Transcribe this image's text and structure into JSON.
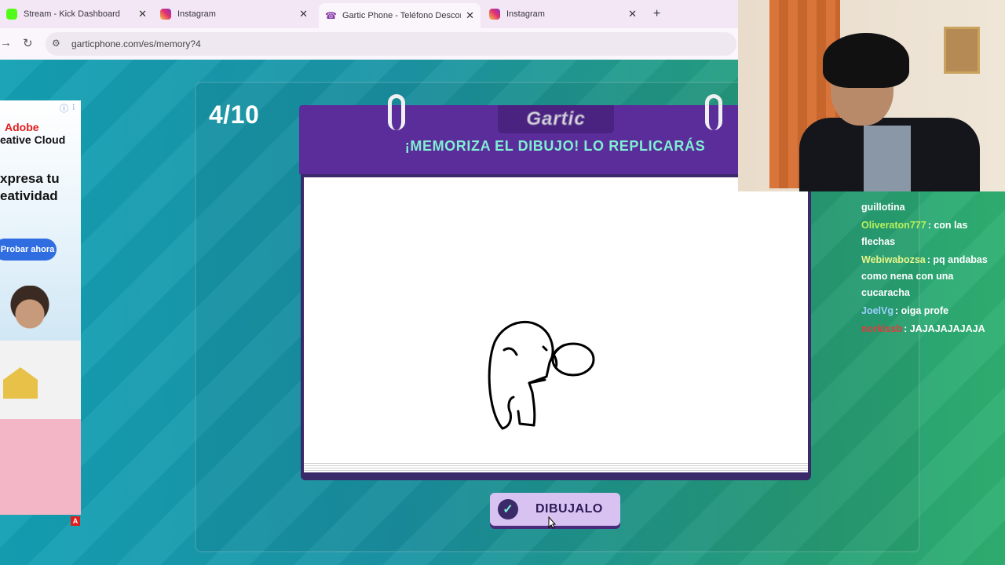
{
  "browser": {
    "tabs": [
      {
        "title": "Stream - Kick Dashboard",
        "favicon": "kick-icon"
      },
      {
        "title": "Instagram",
        "favicon": "instagram-icon"
      },
      {
        "title": "Gartic Phone - Teléfono Descon",
        "favicon": "phone-icon",
        "active": true
      },
      {
        "title": "Instagram",
        "favicon": "instagram-icon"
      }
    ],
    "new_tab_label": "+",
    "close_label": "✕",
    "url": "garticphone.com/es/memory?4"
  },
  "game": {
    "counter": "4/10",
    "logo": "Gartic",
    "instruction": "¡MEMORIZA EL DIBUJO! LO REPLICARÁS",
    "action_button": "DIBUJALO",
    "colors": {
      "header": "#5b2d9b",
      "instruction": "#7ff0d2",
      "button": "#d7c2f2"
    }
  },
  "ad": {
    "info_icon": "ⓘ",
    "close_icon": "⁝",
    "brand": "Adobe",
    "product": "eative Cloud",
    "headline_line1": "xpresa tu",
    "headline_line2": "eatividad",
    "cta": "Probar ahora",
    "badge": "A"
  },
  "chat": {
    "partial_line": "...",
    "messages": [
      {
        "user": "",
        "text": "guillotina",
        "color": "#ffffff"
      },
      {
        "user": "Oliveraton777",
        "text": "con las flechas",
        "color": "#b7f25a"
      },
      {
        "user": "Webiwabozsa",
        "text": "pq andabas como nena con una cucaracha",
        "color": "#e8f58a"
      },
      {
        "user": "JoelVg",
        "text": "oiga profe",
        "color": "#9bd0ff"
      },
      {
        "user": "norkissb",
        "text": "JAJAJAJAJAJA",
        "color": "#e23a3a"
      }
    ]
  }
}
